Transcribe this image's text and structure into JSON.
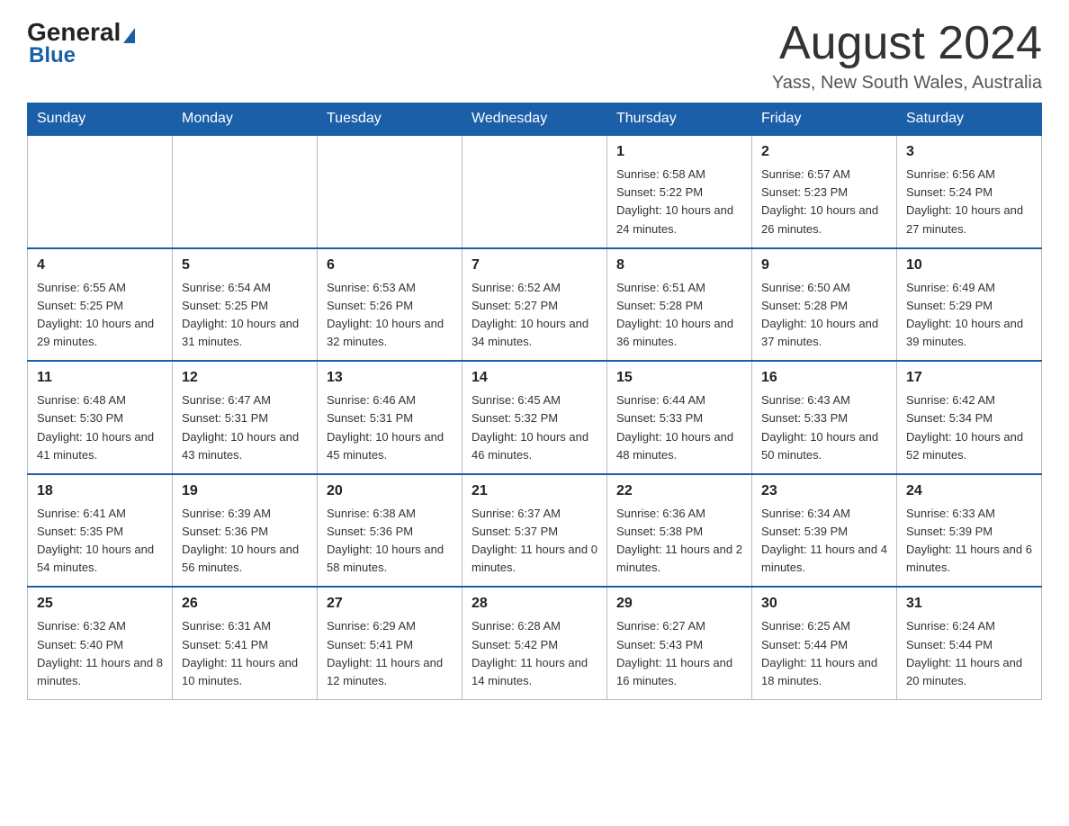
{
  "header": {
    "logo_general": "General",
    "logo_blue": "Blue",
    "month_title": "August 2024",
    "location": "Yass, New South Wales, Australia"
  },
  "days_of_week": [
    "Sunday",
    "Monday",
    "Tuesday",
    "Wednesday",
    "Thursday",
    "Friday",
    "Saturday"
  ],
  "weeks": [
    {
      "days": [
        {
          "number": "",
          "info": ""
        },
        {
          "number": "",
          "info": ""
        },
        {
          "number": "",
          "info": ""
        },
        {
          "number": "",
          "info": ""
        },
        {
          "number": "1",
          "info": "Sunrise: 6:58 AM\nSunset: 5:22 PM\nDaylight: 10 hours and 24 minutes."
        },
        {
          "number": "2",
          "info": "Sunrise: 6:57 AM\nSunset: 5:23 PM\nDaylight: 10 hours and 26 minutes."
        },
        {
          "number": "3",
          "info": "Sunrise: 6:56 AM\nSunset: 5:24 PM\nDaylight: 10 hours and 27 minutes."
        }
      ]
    },
    {
      "days": [
        {
          "number": "4",
          "info": "Sunrise: 6:55 AM\nSunset: 5:25 PM\nDaylight: 10 hours and 29 minutes."
        },
        {
          "number": "5",
          "info": "Sunrise: 6:54 AM\nSunset: 5:25 PM\nDaylight: 10 hours and 31 minutes."
        },
        {
          "number": "6",
          "info": "Sunrise: 6:53 AM\nSunset: 5:26 PM\nDaylight: 10 hours and 32 minutes."
        },
        {
          "number": "7",
          "info": "Sunrise: 6:52 AM\nSunset: 5:27 PM\nDaylight: 10 hours and 34 minutes."
        },
        {
          "number": "8",
          "info": "Sunrise: 6:51 AM\nSunset: 5:28 PM\nDaylight: 10 hours and 36 minutes."
        },
        {
          "number": "9",
          "info": "Sunrise: 6:50 AM\nSunset: 5:28 PM\nDaylight: 10 hours and 37 minutes."
        },
        {
          "number": "10",
          "info": "Sunrise: 6:49 AM\nSunset: 5:29 PM\nDaylight: 10 hours and 39 minutes."
        }
      ]
    },
    {
      "days": [
        {
          "number": "11",
          "info": "Sunrise: 6:48 AM\nSunset: 5:30 PM\nDaylight: 10 hours and 41 minutes."
        },
        {
          "number": "12",
          "info": "Sunrise: 6:47 AM\nSunset: 5:31 PM\nDaylight: 10 hours and 43 minutes."
        },
        {
          "number": "13",
          "info": "Sunrise: 6:46 AM\nSunset: 5:31 PM\nDaylight: 10 hours and 45 minutes."
        },
        {
          "number": "14",
          "info": "Sunrise: 6:45 AM\nSunset: 5:32 PM\nDaylight: 10 hours and 46 minutes."
        },
        {
          "number": "15",
          "info": "Sunrise: 6:44 AM\nSunset: 5:33 PM\nDaylight: 10 hours and 48 minutes."
        },
        {
          "number": "16",
          "info": "Sunrise: 6:43 AM\nSunset: 5:33 PM\nDaylight: 10 hours and 50 minutes."
        },
        {
          "number": "17",
          "info": "Sunrise: 6:42 AM\nSunset: 5:34 PM\nDaylight: 10 hours and 52 minutes."
        }
      ]
    },
    {
      "days": [
        {
          "number": "18",
          "info": "Sunrise: 6:41 AM\nSunset: 5:35 PM\nDaylight: 10 hours and 54 minutes."
        },
        {
          "number": "19",
          "info": "Sunrise: 6:39 AM\nSunset: 5:36 PM\nDaylight: 10 hours and 56 minutes."
        },
        {
          "number": "20",
          "info": "Sunrise: 6:38 AM\nSunset: 5:36 PM\nDaylight: 10 hours and 58 minutes."
        },
        {
          "number": "21",
          "info": "Sunrise: 6:37 AM\nSunset: 5:37 PM\nDaylight: 11 hours and 0 minutes."
        },
        {
          "number": "22",
          "info": "Sunrise: 6:36 AM\nSunset: 5:38 PM\nDaylight: 11 hours and 2 minutes."
        },
        {
          "number": "23",
          "info": "Sunrise: 6:34 AM\nSunset: 5:39 PM\nDaylight: 11 hours and 4 minutes."
        },
        {
          "number": "24",
          "info": "Sunrise: 6:33 AM\nSunset: 5:39 PM\nDaylight: 11 hours and 6 minutes."
        }
      ]
    },
    {
      "days": [
        {
          "number": "25",
          "info": "Sunrise: 6:32 AM\nSunset: 5:40 PM\nDaylight: 11 hours and 8 minutes."
        },
        {
          "number": "26",
          "info": "Sunrise: 6:31 AM\nSunset: 5:41 PM\nDaylight: 11 hours and 10 minutes."
        },
        {
          "number": "27",
          "info": "Sunrise: 6:29 AM\nSunset: 5:41 PM\nDaylight: 11 hours and 12 minutes."
        },
        {
          "number": "28",
          "info": "Sunrise: 6:28 AM\nSunset: 5:42 PM\nDaylight: 11 hours and 14 minutes."
        },
        {
          "number": "29",
          "info": "Sunrise: 6:27 AM\nSunset: 5:43 PM\nDaylight: 11 hours and 16 minutes."
        },
        {
          "number": "30",
          "info": "Sunrise: 6:25 AM\nSunset: 5:44 PM\nDaylight: 11 hours and 18 minutes."
        },
        {
          "number": "31",
          "info": "Sunrise: 6:24 AM\nSunset: 5:44 PM\nDaylight: 11 hours and 20 minutes."
        }
      ]
    }
  ]
}
